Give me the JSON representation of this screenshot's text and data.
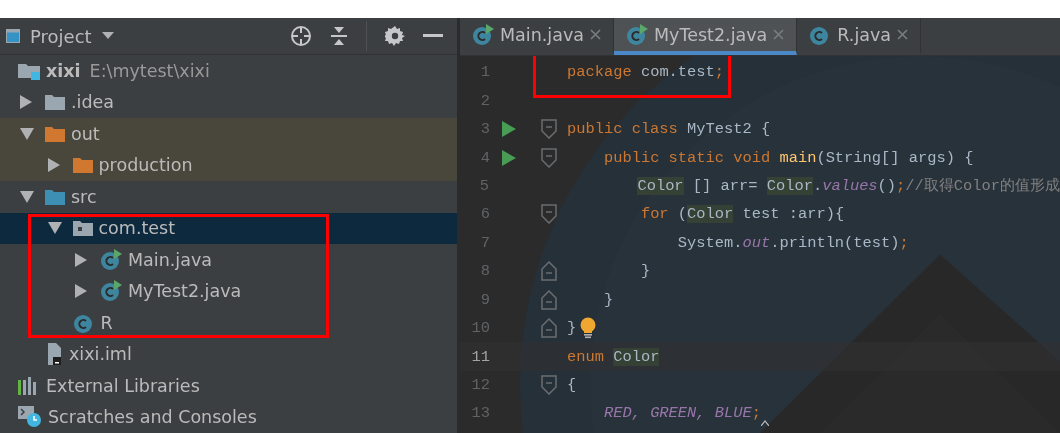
{
  "project_panel": {
    "title": "Project",
    "tree": [
      {
        "label": "xixi",
        "path": "E:\\mytest\\xixi",
        "kind": "module",
        "excluded": false,
        "children": [
          {
            "label": ".idea",
            "kind": "folder",
            "color": "#9aa7b0",
            "expanded": false,
            "excluded": false
          },
          {
            "label": "out",
            "kind": "folder",
            "color": "#d0782f",
            "expanded": true,
            "excluded": true,
            "children": [
              {
                "label": "production",
                "kind": "folder",
                "color": "#d0782f",
                "expanded": false,
                "excluded": true
              }
            ]
          },
          {
            "label": "src",
            "kind": "folder",
            "color": "#3d8fb4",
            "expanded": true,
            "excluded": false,
            "children_highlighted": true,
            "children": [
              {
                "label": "com.test",
                "kind": "package",
                "expanded": true,
                "excluded": false,
                "selected": true,
                "children": [
                  {
                    "label": "Main.java",
                    "kind": "class",
                    "runnable": true,
                    "expanded": false,
                    "excluded": false,
                    "selected": false
                  },
                  {
                    "label": "MyTest2.java",
                    "kind": "class",
                    "runnable": true,
                    "expanded": false,
                    "excluded": false,
                    "selected": false
                  }
                ]
              },
              {
                "label": "R",
                "kind": "class",
                "runnable": false,
                "excluded": false,
                "selected": false
              }
            ]
          },
          {
            "label": "xixi.iml",
            "kind": "file",
            "excluded": false
          }
        ]
      },
      {
        "label": "External Libraries",
        "kind": "libraries",
        "excluded": false
      },
      {
        "label": "Scratches and Consoles",
        "kind": "scratches",
        "excluded": false
      }
    ]
  },
  "editor": {
    "tabs": [
      {
        "label": "Main.java",
        "runnable": true,
        "selected": false
      },
      {
        "label": "MyTest2.java",
        "runnable": true,
        "selected": true
      },
      {
        "label": "R.java",
        "runnable": false,
        "selected": false
      }
    ],
    "lines": [
      {
        "number": "1",
        "current": false,
        "highlighted": true,
        "tokens": [
          {
            "text": "package",
            "kind": "keyword"
          },
          {
            "text": " com.test",
            "kind": "plain"
          },
          {
            "text": ";",
            "kind": "keyword"
          }
        ]
      },
      {
        "number": "2",
        "current": false,
        "highlighted": false
      },
      {
        "number": "3",
        "current": false,
        "highlighted": false,
        "run": true,
        "fold_open": true,
        "tokens": [
          {
            "text": "public class ",
            "kind": "keyword"
          },
          {
            "text": "MyTest2 {",
            "kind": "plain"
          }
        ]
      },
      {
        "number": "4",
        "current": false,
        "highlighted": false,
        "run": true,
        "fold_open": true,
        "tokens": [
          {
            "text": "    public static void ",
            "kind": "keyword"
          },
          {
            "text": "main",
            "kind": "method"
          },
          {
            "text": "(String[] args) {",
            "kind": "plain"
          }
        ]
      },
      {
        "number": "5",
        "current": false,
        "highlighted": false,
        "tokens": [
          {
            "text": "        Color",
            "kind": "type"
          },
          {
            "text": " [] arr= ",
            "kind": "plain"
          },
          {
            "text": "Color",
            "kind": "type"
          },
          {
            "text": ".",
            "kind": "plain"
          },
          {
            "text": "values",
            "kind": "static"
          },
          {
            "text": "()",
            "kind": "plain"
          },
          {
            "text": ";",
            "kind": "keyword"
          },
          {
            "text": "//取得Color的值形成",
            "kind": "comment"
          }
        ]
      },
      {
        "number": "6",
        "current": false,
        "highlighted": false,
        "fold_open": true,
        "tokens": [
          {
            "text": "        for ",
            "kind": "keyword"
          },
          {
            "text": "(",
            "kind": "plain"
          },
          {
            "text": "Color",
            "kind": "type"
          },
          {
            "text": " test :arr){",
            "kind": "plain"
          }
        ]
      },
      {
        "number": "7",
        "current": false,
        "highlighted": false,
        "tokens": [
          {
            "text": "            System.",
            "kind": "plain"
          },
          {
            "text": "out",
            "kind": "static"
          },
          {
            "text": ".println(test)",
            "kind": "plain"
          },
          {
            "text": ";",
            "kind": "keyword"
          }
        ]
      },
      {
        "number": "8",
        "current": false,
        "highlighted": false,
        "fold_close": true,
        "tokens": [
          {
            "text": "        }",
            "kind": "plain"
          }
        ]
      },
      {
        "number": "9",
        "current": false,
        "highlighted": false,
        "fold_close": true,
        "tokens": [
          {
            "text": "    }",
            "kind": "plain"
          }
        ]
      },
      {
        "number": "10",
        "current": false,
        "highlighted": false,
        "fold_close": true,
        "bulb": true,
        "tokens": [
          {
            "text": "}",
            "kind": "plain"
          }
        ]
      },
      {
        "number": "11",
        "current": true,
        "highlighted": false,
        "tokens": [
          {
            "text": "enum ",
            "kind": "keyword"
          },
          {
            "text": "Color",
            "kind": "type"
          }
        ]
      },
      {
        "number": "12",
        "current": false,
        "highlighted": false,
        "fold_open": true,
        "tokens": [
          {
            "text": "{",
            "kind": "plain"
          }
        ]
      },
      {
        "number": "13",
        "current": false,
        "highlighted": false,
        "caret": true,
        "tokens": [
          {
            "text": "    RED, GREEN, BLUE",
            "kind": "constant"
          },
          {
            "text": ";",
            "kind": "keyword"
          }
        ]
      }
    ]
  }
}
